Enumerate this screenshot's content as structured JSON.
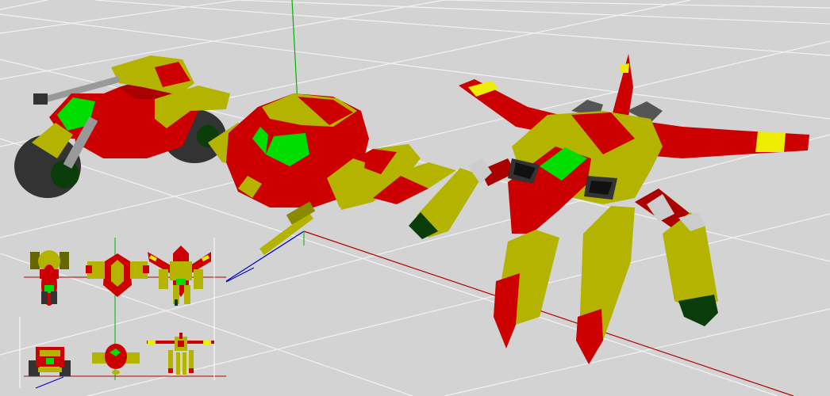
{
  "scene": {
    "title": "",
    "background_color": "#d3d3d3",
    "grid_color": "#f2f2f2",
    "axis_colors": {
      "x": "#b30000",
      "y": "#00b300",
      "z": "#0000cc"
    },
    "palette": {
      "red": "#cc0000",
      "yellow": "#b3b300",
      "green": "#00dd00",
      "gray": "#999999",
      "dark": "#333333",
      "dark_green": "#0a3d0a"
    }
  },
  "models": [
    {
      "name": "hover-bike",
      "view": "perspective"
    },
    {
      "name": "pod-vehicle",
      "view": "perspective"
    },
    {
      "name": "walker-mech",
      "view": "perspective"
    }
  ],
  "thumbnails": [
    {
      "name": "bike-top",
      "view": "top"
    },
    {
      "name": "pod-top",
      "view": "top"
    },
    {
      "name": "mech-top",
      "view": "top"
    },
    {
      "name": "bike-front",
      "view": "front"
    },
    {
      "name": "pod-front",
      "view": "front"
    },
    {
      "name": "mech-front",
      "view": "front"
    }
  ]
}
